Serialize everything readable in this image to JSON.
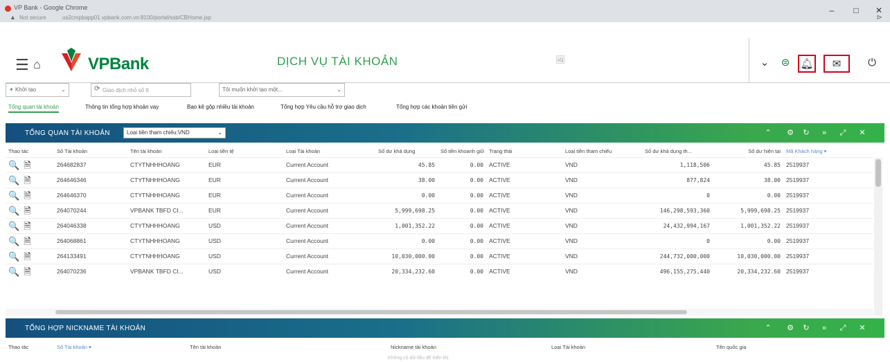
{
  "browser": {
    "window_title": "VP Bank - Google Chrome",
    "security_label": "Not secure",
    "url": "us2cmpbapp01.vpbank.com.vn:8100/portal/ssb/CBHome.jsp"
  },
  "header": {
    "brand": "VPBank",
    "service_title": "DỊCH VỤ TÀI KHOẢN"
  },
  "toolbar": {
    "create_select": "Khởi tạo",
    "search_placeholder": "Giao dịch nhỏ số tt",
    "intent_select": "Tôi muốn khởi tạo một..."
  },
  "tabs": [
    {
      "label": "Tổng quan tài khoản",
      "active": true
    },
    {
      "label": "Thông tin tổng hợp khoản vay",
      "active": false
    },
    {
      "label": "Bao kê gộp nhiều tài khoản",
      "active": false
    },
    {
      "label": "Tổng hợp Yêu cầu hỗ trợ giao dịch",
      "active": false
    },
    {
      "label": "Tổng hợp các khoản tiền gửi",
      "active": false
    }
  ],
  "panel1": {
    "title": "TỔNG QUAN TÀI KHOẢN",
    "currency_select": "Loại tiền tham chiếu:VND",
    "columns": [
      "Thao tác",
      "Số Tài khoản",
      "Tên tài khoản",
      "Loại tiền tệ",
      "Loại Tài khoản",
      "Số dư khả dụng",
      "Số tiền khoanh giữ",
      "Trạng thái",
      "Loại tiền tham chiếu",
      "Số dư khả dụng th...",
      "Số dư hiện tại",
      "Mã Khách hàng ▾"
    ],
    "rows": [
      {
        "acct": "264682837",
        "name": "CTYTNHHHOANG",
        "ccy": "EUR",
        "type": "Current Account",
        "avail": "45.85",
        "hold": "0.00",
        "status": "ACTIVE",
        "ref_ccy": "VND",
        "avail_ref": "1,118,506",
        "current": "45.85",
        "cif": "2519937"
      },
      {
        "acct": "264646346",
        "name": "CTYTNHHHOANG",
        "ccy": "EUR",
        "type": "Current Account",
        "avail": "38.00",
        "hold": "0.00",
        "status": "ACTIVE",
        "ref_ccy": "VND",
        "avail_ref": "877,824",
        "current": "38.00",
        "cif": "2519937"
      },
      {
        "acct": "264646370",
        "name": "CTYTNHHHOANG",
        "ccy": "EUR",
        "type": "Current Account",
        "avail": "0.00",
        "hold": "0.00",
        "status": "ACTIVE",
        "ref_ccy": "VND",
        "avail_ref": "0",
        "current": "0.00",
        "cif": "2519937"
      },
      {
        "acct": "264070244",
        "name": "VPBANK TBFD CI...",
        "ccy": "EUR",
        "type": "Current Account",
        "avail": "5,999,698.25",
        "hold": "0.00",
        "status": "ACTIVE",
        "ref_ccy": "VND",
        "avail_ref": "146,298,593,360",
        "current": "5,999,698.25",
        "cif": "2519937"
      },
      {
        "acct": "264046338",
        "name": "CTYTNHHHOANG",
        "ccy": "USD",
        "type": "Current Account",
        "avail": "1,001,352.22",
        "hold": "0.00",
        "status": "ACTIVE",
        "ref_ccy": "VND",
        "avail_ref": "24,432,994,167",
        "current": "1,001,352.22",
        "cif": "2519937"
      },
      {
        "acct": "264068861",
        "name": "CTYTNHHHOANG",
        "ccy": "USD",
        "type": "Current Account",
        "avail": "0.00",
        "hold": "0.00",
        "status": "ACTIVE",
        "ref_ccy": "VND",
        "avail_ref": "0",
        "current": "0.00",
        "cif": "2519937"
      },
      {
        "acct": "264133491",
        "name": "CTYTNHHHOANG",
        "ccy": "USD",
        "type": "Current Account",
        "avail": "10,030,000.00",
        "hold": "0.00",
        "status": "ACTIVE",
        "ref_ccy": "VND",
        "avail_ref": "244,732,000,000",
        "current": "10,030,000.00",
        "cif": "2519937"
      },
      {
        "acct": "264070236",
        "name": "VPBANK TBFD CI...",
        "ccy": "USD",
        "type": "Current Account",
        "avail": "20,334,232.60",
        "hold": "0.00",
        "status": "ACTIVE",
        "ref_ccy": "VND",
        "avail_ref": "496,155,275,440",
        "current": "20,334,232.60",
        "cif": "2519937"
      }
    ]
  },
  "panel2": {
    "title": "TỔNG HỢP NICKNAME TÀI KHOẢN",
    "columns": [
      "Thao tác",
      "Số Tài khoản ▾",
      "Tên tài khoản",
      "Nickname tài khoản",
      "Loại Tài khoản",
      "Tên quốc gia"
    ]
  },
  "footer_text": "Không có dữ liệu để hiển thị",
  "icons": {
    "view": "🔍",
    "doc": "🗎"
  }
}
